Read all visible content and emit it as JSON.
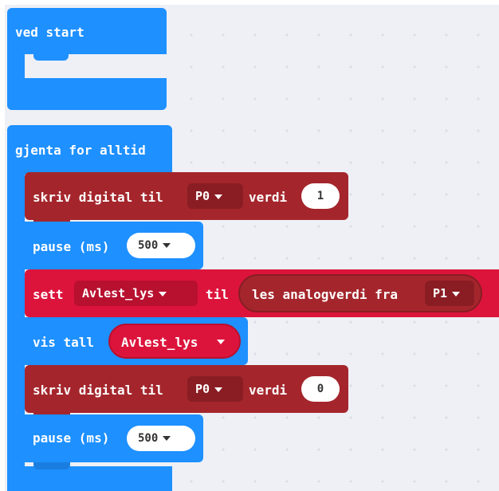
{
  "on_start": {
    "label": "ved start"
  },
  "forever": {
    "label": "gjenta for alltid"
  },
  "blocks": {
    "digital_write_1": {
      "prefix": "skriv digital til",
      "pin": "P0",
      "value_label": "verdi",
      "value": "1"
    },
    "pause_1": {
      "prefix": "pause (ms)",
      "value": "500"
    },
    "set_var": {
      "prefix": "sett",
      "variable": "Avlest_lys",
      "to_label": "til",
      "read_label": "les analogverdi fra",
      "pin": "P1"
    },
    "show_number": {
      "prefix": "vis tall",
      "variable": "Avlest_lys"
    },
    "digital_write_2": {
      "prefix": "skriv digital til",
      "pin": "P0",
      "value_label": "verdi",
      "value": "0"
    },
    "pause_2": {
      "prefix": "pause (ms)",
      "value": "500"
    }
  },
  "colors": {
    "basic_blue": "#1e90ff",
    "pins_red": "#a4262c",
    "variables_crimson": "#dc143c",
    "workspace": "#eef0f5"
  }
}
